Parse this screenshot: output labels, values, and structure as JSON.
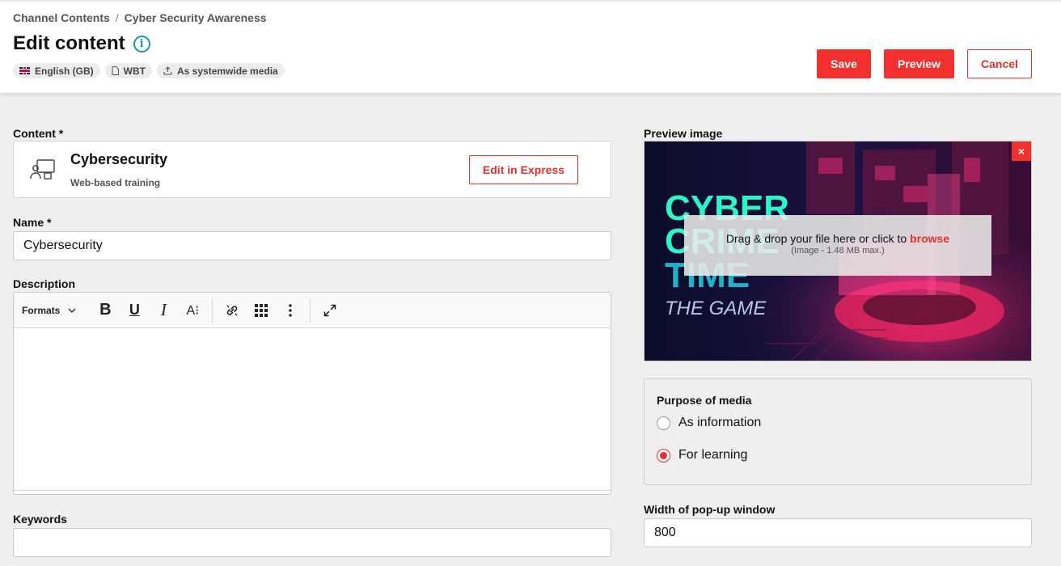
{
  "breadcrumb": {
    "parent": "Channel Contents",
    "separator": "/",
    "current": "Cyber Security Awareness"
  },
  "page_title": "Edit content",
  "chips": {
    "language": "English (GB)",
    "type": "WBT",
    "media": "As systemwide media"
  },
  "actions": {
    "save": "Save",
    "preview": "Preview",
    "cancel": "Cancel"
  },
  "content_section": {
    "label": "Content *",
    "name": "Cybersecurity",
    "type": "Web-based training",
    "edit_button": "Edit in Express"
  },
  "name_field": {
    "label": "Name *",
    "value": "Cybersecurity"
  },
  "description": {
    "label": "Description",
    "toolbar": {
      "formats": "Formats",
      "bold": "B",
      "underline": "U",
      "italic": "I",
      "font_size": "A⁝"
    }
  },
  "keywords": {
    "label": "Keywords",
    "value": ""
  },
  "preview_image": {
    "label": "Preview image",
    "remove": "×",
    "image_text": {
      "line1": "CYBER",
      "line2": "CRIME",
      "line3": "TIME",
      "line4": "THE GAME"
    },
    "drop_prefix": "Drag & drop your file here or click to ",
    "drop_link": "browse",
    "drop_hint": "(Image - 1.48 MB max.)"
  },
  "purpose": {
    "label": "Purpose of media",
    "options": [
      {
        "label": "As information",
        "checked": false
      },
      {
        "label": "For learning",
        "checked": true
      }
    ]
  },
  "popup_width": {
    "label": "Width of pop-up window",
    "value": "800"
  },
  "colors": {
    "accent": "#f2312f",
    "info": "#1a9a9a"
  }
}
